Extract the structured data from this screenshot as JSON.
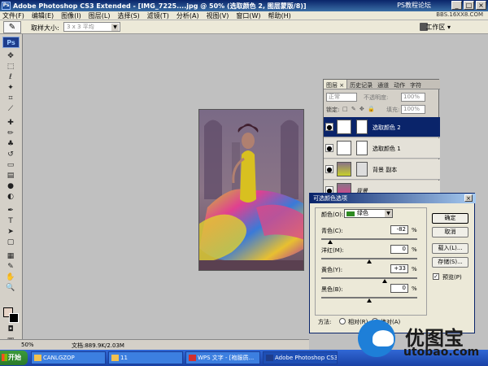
{
  "window": {
    "title": "Adobe Photoshop CS3 Extended - [IMG_7225....jpg @ 50% (选取颜色 2, 图层蒙版/8)]",
    "watermark_top": "PS教程论坛",
    "min": "_",
    "max": "□",
    "close": "×"
  },
  "menu": {
    "items": [
      "文件(F)",
      "编辑(E)",
      "图像(I)",
      "图层(L)",
      "选择(S)",
      "滤镜(T)",
      "分析(A)",
      "视图(V)",
      "窗口(W)",
      "帮助(H)"
    ],
    "watermark": "BBS.16XX8.COM"
  },
  "options": {
    "sample_label": "取样大小:",
    "sample_value": "3 x 3 平均",
    "workspace_label": "工作区 ▾",
    "tool_icon": "eyedropper-icon"
  },
  "toolbox": {
    "logo": "Ps"
  },
  "layers_panel": {
    "tabs": [
      "图层 ×",
      "历史记录",
      "通道",
      "动作",
      "字符"
    ],
    "blend_mode": "正常",
    "opacity_label": "不透明度:",
    "opacity": "100%",
    "lock_label": "锁定:",
    "lock_icons": "□ ✎ ✥ 🔒",
    "fill_label": "填充:",
    "fill": "100%",
    "layers": [
      {
        "name": "选取颜色 2",
        "selected": true
      },
      {
        "name": "选取颜色 1",
        "selected": false
      },
      {
        "name": "背景 副本",
        "selected": false
      },
      {
        "name": "背景",
        "selected": false
      }
    ]
  },
  "dialog": {
    "title": "可选颜色选项",
    "close": "×",
    "color_label": "颜色(O):",
    "color_value": "绿色",
    "color_swatch": "#2e8b22",
    "sliders": [
      {
        "label": "青色(C):",
        "value": "-82",
        "unit": "%",
        "level": -82
      },
      {
        "label": "洋红(M):",
        "value": "0",
        "unit": "%",
        "level": 0
      },
      {
        "label": "黄色(Y):",
        "value": "+33",
        "unit": "%",
        "level": 33
      },
      {
        "label": "黑色(B):",
        "value": "0",
        "unit": "%",
        "level": 0
      }
    ],
    "method_label": "方法:",
    "method_relative": "相对(R)",
    "method_absolute": "绝对(A)",
    "method_selected": "absolute",
    "buttons": {
      "ok": "确定",
      "cancel": "取消",
      "load": "载入(L)...",
      "save": "存储(S)..."
    },
    "preview_label": "预览(P)",
    "preview_checked": true
  },
  "status": {
    "zoom": "50%",
    "doc": "文档:889.9K/2.03M"
  },
  "taskbar": {
    "start": "开始",
    "tasks": [
      "CANLGZOP",
      "11",
      "WPS 文字 - [袍服质...",
      "Adobe Photoshop CS3..."
    ]
  },
  "watermark": {
    "cn": "优图宝",
    "en": "utobao.com"
  }
}
